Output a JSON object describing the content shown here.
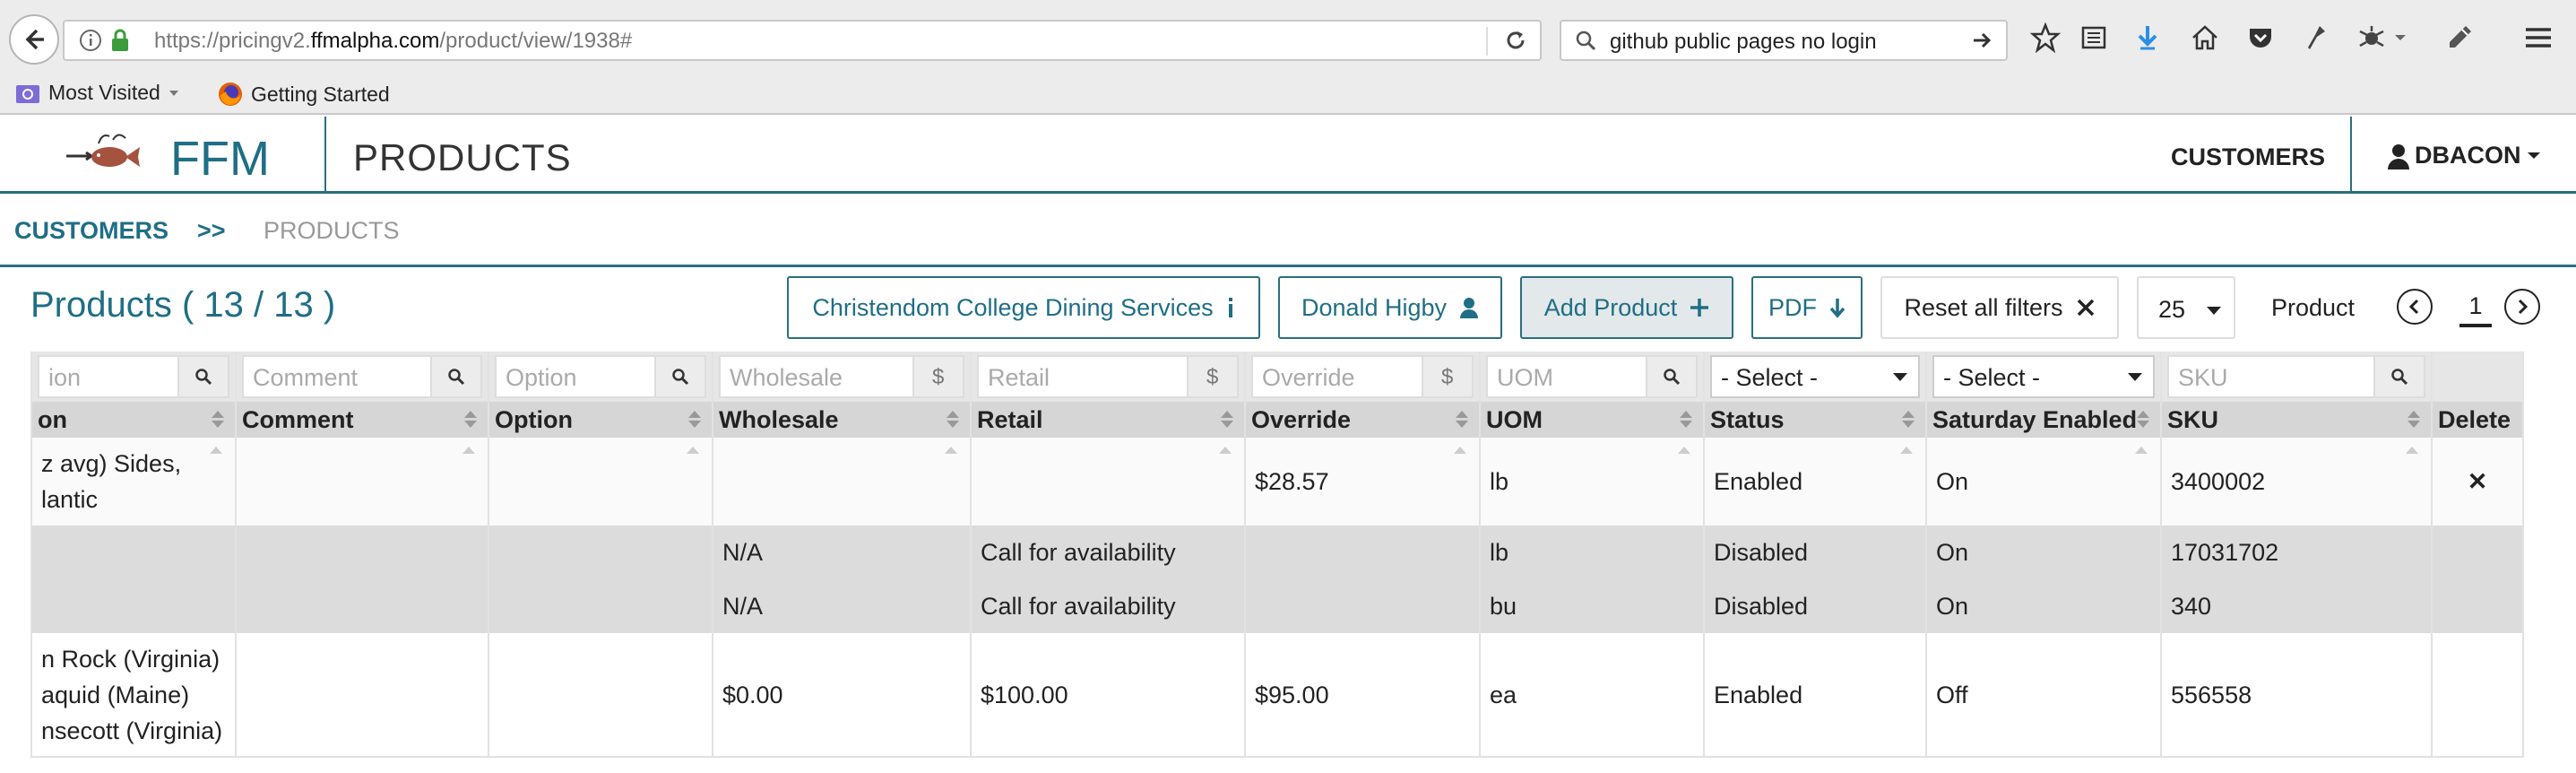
{
  "browser": {
    "url_prefix": "https://pricingv2.",
    "url_domain": "ffmalpha.com",
    "url_path": "/product/view/1938#",
    "search_text": "github public pages no login",
    "bookmarks": [
      "Most Visited",
      "Getting Started"
    ]
  },
  "header": {
    "brand": "FFM",
    "page_title": "PRODUCTS",
    "nav_customers": "CUSTOMERS",
    "user": "DBACON"
  },
  "breadcrumb": {
    "first": "CUSTOMERS",
    "separator": ">>",
    "current": "PRODUCTS"
  },
  "toolbar": {
    "title": "Products ( 13 / 13 )",
    "customer_button": "Christendom College Dining Services",
    "contact_button": "Donald Higby",
    "add_button": "Add Product",
    "pdf_button": "PDF",
    "reset_button": "Reset all filters",
    "page_size": "25",
    "pager_label": "Product",
    "page_number": "1"
  },
  "filters": {
    "description": "ion",
    "comment": "Comment",
    "option": "Option",
    "wholesale": "Wholesale",
    "retail": "Retail",
    "override": "Override",
    "uom": "UOM",
    "status_select": "- Select -",
    "saturday_select": "- Select -",
    "sku": "SKU"
  },
  "columns": [
    "on",
    "Comment",
    "Option",
    "Wholesale",
    "Retail",
    "Override",
    "UOM",
    "Status",
    "Saturday Enabled",
    "SKU",
    "Delete"
  ],
  "rows": [
    {
      "desc1": "z avg) Sides,",
      "desc2": "lantic",
      "desc3": "",
      "comment": "",
      "option": "",
      "wholesale": "",
      "retail": "",
      "override": "$28.57",
      "uom": "lb",
      "status": "Enabled",
      "saturday": "On",
      "sku": "3400002",
      "delete": "✕"
    },
    {
      "desc1": "",
      "desc2": "",
      "desc3": "",
      "comment": "",
      "option": "",
      "wholesale": "N/A",
      "retail": "Call for availability",
      "override": "",
      "uom": "lb",
      "status": "Disabled",
      "saturday": "On",
      "sku": "17031702",
      "delete": ""
    },
    {
      "desc1": "",
      "desc2": "",
      "desc3": "",
      "comment": "",
      "option": "",
      "wholesale": "N/A",
      "retail": "Call for availability",
      "override": "",
      "uom": "bu",
      "status": "Disabled",
      "saturday": "On",
      "sku": "340",
      "delete": ""
    },
    {
      "desc1": "n Rock (Virginia)",
      "desc2": "aquid (Maine)",
      "desc3": "nsecott (Virginia)",
      "comment": "",
      "option": "",
      "wholesale": "$0.00",
      "retail": "$100.00",
      "override": "$95.00",
      "uom": "ea",
      "status": "Enabled",
      "saturday": "Off",
      "sku": "556558",
      "delete": ""
    }
  ],
  "colors": {
    "accent": "#1f6e85",
    "delete": "#e00000"
  }
}
